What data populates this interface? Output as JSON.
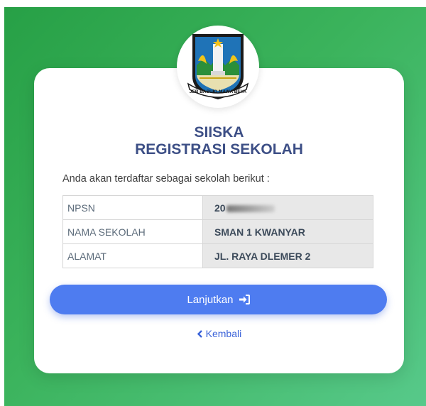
{
  "app": {
    "title": "SIISKA",
    "subtitle": "REGISTRASI SEKOLAH"
  },
  "logo": {
    "icon": "jawa-timur-emblem",
    "motto": "JER BASUKI MAWA BEYA"
  },
  "intro_text": "Anda akan terdaftar sebagai sekolah berikut :",
  "school": {
    "rows": [
      {
        "label": "NPSN",
        "value": "20"
      },
      {
        "label": "NAMA SEKOLAH",
        "value": "SMAN 1 KWANYAR"
      },
      {
        "label": "ALAMAT",
        "value": "JL. RAYA DLEMER 2"
      }
    ]
  },
  "actions": {
    "continue_label": "Lanjutkan",
    "continue_icon": "sign-in-icon",
    "back_label": "Kembali",
    "back_icon": "chevron-left-icon"
  },
  "colors": {
    "background": "#33ab56",
    "primary_button": "#4e7cf0",
    "title": "#3d4f86",
    "link": "#3b63d9"
  }
}
